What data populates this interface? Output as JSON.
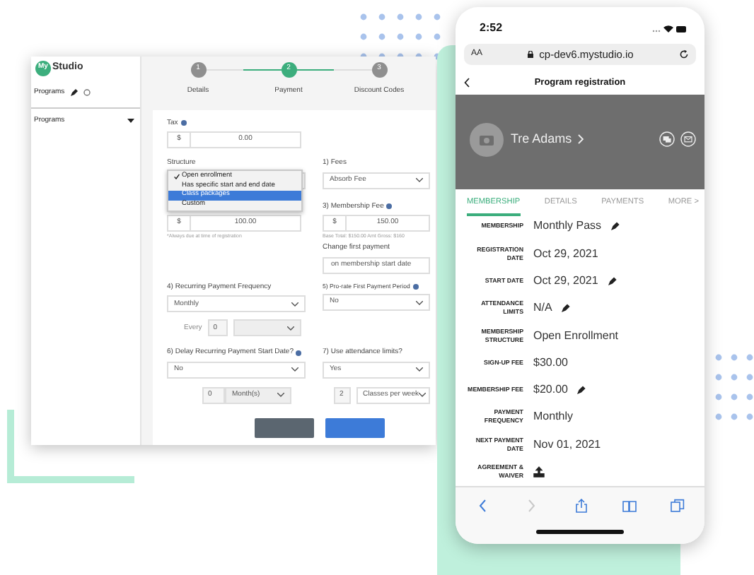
{
  "desktop": {
    "logo": {
      "mark": "My",
      "text": "Studio"
    },
    "sidebar": {
      "header": "Programs",
      "items": [
        {
          "label": "Programs"
        }
      ]
    },
    "stepper": [
      {
        "number": "1",
        "label": "Details",
        "selected": false
      },
      {
        "number": "2",
        "label": "Payment",
        "selected": true
      },
      {
        "number": "3",
        "label": "Discount Codes",
        "selected": false
      }
    ],
    "tax": {
      "label": "Tax",
      "info": true,
      "prefix": "$",
      "value": "0.00"
    },
    "structure": {
      "label": "Structure",
      "options": [
        {
          "label": "Open enrollment",
          "checked": true,
          "selected": false
        },
        {
          "label": "Has specific start and end date",
          "checked": false,
          "selected": false
        },
        {
          "label": "Class packages",
          "checked": false,
          "selected": true
        },
        {
          "label": "Custom",
          "checked": false,
          "selected": false
        }
      ]
    },
    "fees": {
      "label": "1) Fees",
      "value": "Absorb Fee"
    },
    "signup_fee": {
      "prefix": "$",
      "value": "100.00",
      "hint": "*Always due at time of registration"
    },
    "membership_fee": {
      "label": "3) Membership Fee",
      "info": true,
      "prefix": "$",
      "value": "150.00",
      "hint": "Base Total: $150.00 Amt Gross: $160"
    },
    "first_payment": {
      "label": "Change first payment",
      "value": "on membership start date"
    },
    "frequency": {
      "label": "4) Recurring Payment Frequency",
      "info": false,
      "value": "Monthly",
      "every_label": "Every",
      "every_value": "0"
    },
    "prorate": {
      "label": "5) Pro-rate First Payment Period",
      "info": true,
      "value": "No"
    },
    "delay": {
      "label": "6) Delay Recurring Payment Start Date?",
      "info": true,
      "value": "No",
      "count": "0",
      "unit": "Month(s)"
    },
    "attendance": {
      "label": "7) Use attendance limits?",
      "info": false,
      "value": "Yes",
      "count": "2",
      "unit": "Classes per week"
    },
    "buttons": [
      {
        "kind": "secondary"
      },
      {
        "kind": "primary"
      }
    ]
  },
  "phone": {
    "time": "2:52",
    "text_size": "AA",
    "url": "cp-dev6.mystudio.io",
    "page_title": "Program registration",
    "member": "Tre Adams",
    "tabs": [
      {
        "label": "MEMBERSHIP",
        "selected": true
      },
      {
        "label": "DETAILS",
        "selected": false
      },
      {
        "label": "PAYMENTS",
        "selected": false
      },
      {
        "label": "MORE >",
        "selected": false
      }
    ],
    "fields": [
      {
        "label": "MEMBERSHIP",
        "value": "Monthly Pass",
        "editable": true
      },
      {
        "label": "REGISTRATION DATE",
        "value": "Oct 29, 2021",
        "editable": false
      },
      {
        "label": "START DATE",
        "value": "Oct 29, 2021",
        "editable": true
      },
      {
        "label": "ATTENDANCE LIMITS",
        "value": "N/A",
        "editable": true
      },
      {
        "label": "MEMBERSHIP STRUCTURE",
        "value": "Open Enrollment",
        "editable": false
      },
      {
        "label": "SIGN-UP FEE",
        "value": "$30.00",
        "editable": false
      },
      {
        "label": "MEMBERSHIP FEE",
        "value": "$20.00",
        "editable": true
      },
      {
        "label": "PAYMENT FREQUENCY",
        "value": "Monthly",
        "editable": false
      },
      {
        "label": "NEXT PAYMENT DATE",
        "value": "Nov 01, 2021",
        "editable": false
      },
      {
        "label": "AGREEMENT & WAIVER",
        "kind": "upload"
      }
    ],
    "toolbar": [
      {
        "kind": "back",
        "disabled": false
      },
      {
        "kind": "forward",
        "disabled": true
      },
      {
        "kind": "share",
        "disabled": false
      },
      {
        "kind": "bookmarks",
        "disabled": false
      },
      {
        "kind": "tabs",
        "disabled": false
      }
    ]
  }
}
